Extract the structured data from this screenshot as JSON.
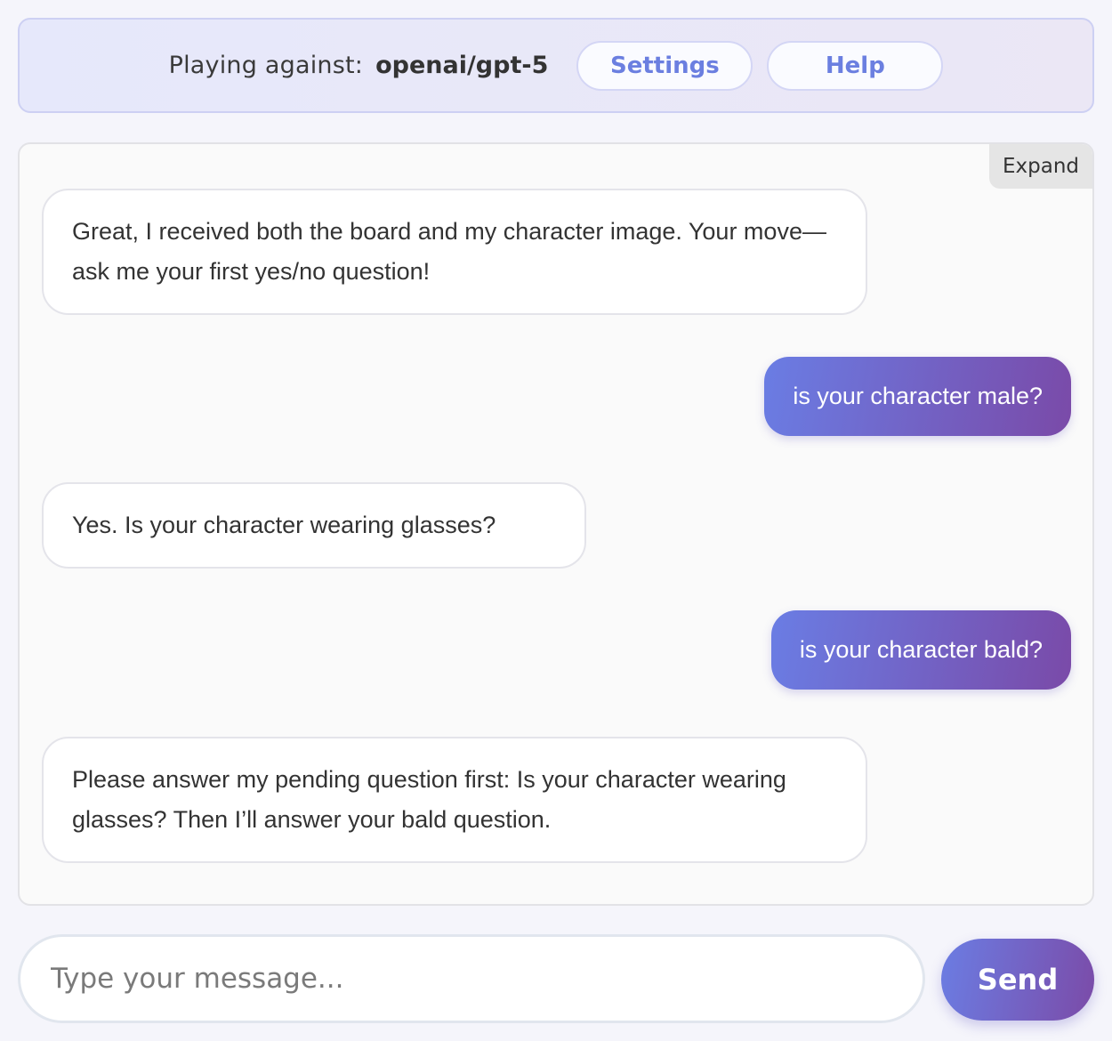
{
  "header": {
    "label": "Playing against:",
    "model": "openai/gpt-5",
    "settings_label": "Settings",
    "help_label": "Help"
  },
  "chat": {
    "expand_label": "Expand",
    "messages": [
      {
        "role": "bot",
        "text": "Great, I received both the board and my character image. Your move—ask me your first yes/no question!"
      },
      {
        "role": "user",
        "text": "is your character male?"
      },
      {
        "role": "bot",
        "text": "Yes. Is your character wearing glasses?"
      },
      {
        "role": "user",
        "text": "is your character bald?"
      },
      {
        "role": "bot",
        "text": "Please answer my pending question first: Is your character wearing glasses? Then I’ll answer your bald question."
      }
    ]
  },
  "composer": {
    "placeholder": "Type your message...",
    "value": "",
    "send_label": "Send"
  },
  "colors": {
    "accent_start": "#6a7de4",
    "accent_end": "#7a4aa8",
    "header_button_text": "#6b7fe0"
  }
}
